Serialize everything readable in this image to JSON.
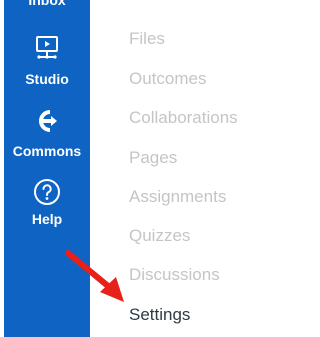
{
  "sidebar": {
    "background": "#0f63c2",
    "items": [
      {
        "label": "Inbox",
        "icon": "inbox-icon"
      },
      {
        "label": "Studio",
        "icon": "studio-icon"
      },
      {
        "label": "Commons",
        "icon": "commons-icon"
      },
      {
        "label": "Help",
        "icon": "help-icon"
      }
    ]
  },
  "course_nav": {
    "items": [
      {
        "label": "Files"
      },
      {
        "label": "Outcomes"
      },
      {
        "label": "Collaborations"
      },
      {
        "label": "Pages"
      },
      {
        "label": "Assignments"
      },
      {
        "label": "Quizzes"
      },
      {
        "label": "Discussions"
      },
      {
        "label": "Settings"
      }
    ],
    "active": "Settings",
    "inactive_color": "#c5c5c5",
    "active_color": "#2d3b45"
  },
  "annotation": {
    "arrow_color": "#e8201a",
    "points_to": "Settings"
  }
}
